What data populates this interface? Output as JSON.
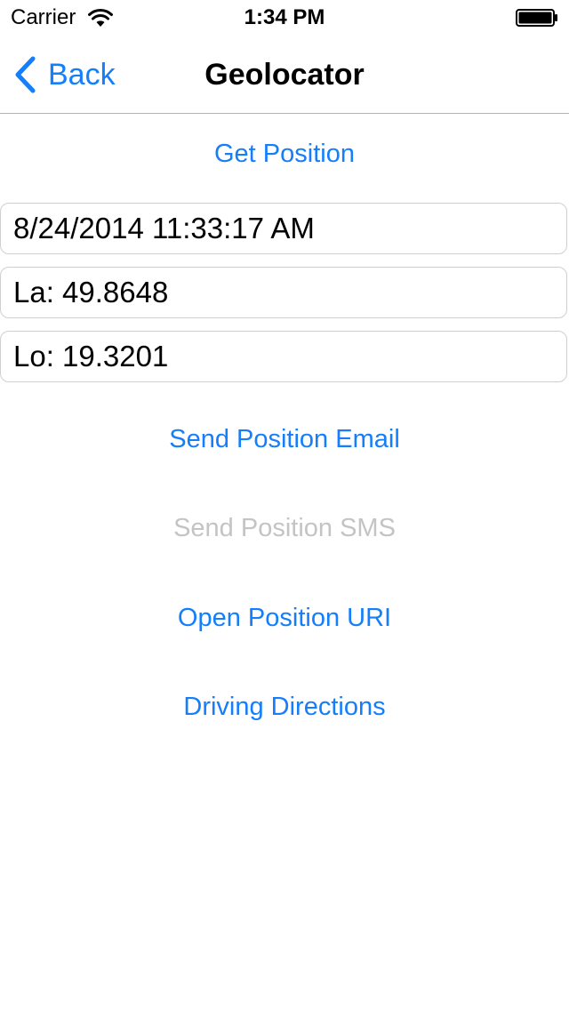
{
  "status_bar": {
    "carrier": "Carrier",
    "time": "1:34 PM",
    "wifi_icon": "wifi-icon",
    "battery_icon": "battery-icon"
  },
  "nav": {
    "back_label": "Back",
    "back_icon": "chevron-left-icon",
    "title": "Geolocator"
  },
  "buttons": {
    "get_position": "Get Position",
    "send_email": "Send Position Email",
    "send_sms": "Send Position SMS",
    "open_uri": "Open Position URI",
    "driving_directions": "Driving Directions"
  },
  "fields": {
    "timestamp": "8/24/2014 11:33:17 AM",
    "latitude": "La: 49.8648",
    "longitude": "Lo: 19.3201"
  },
  "colors": {
    "accent": "#147efb",
    "disabled": "#c4c4c4"
  }
}
